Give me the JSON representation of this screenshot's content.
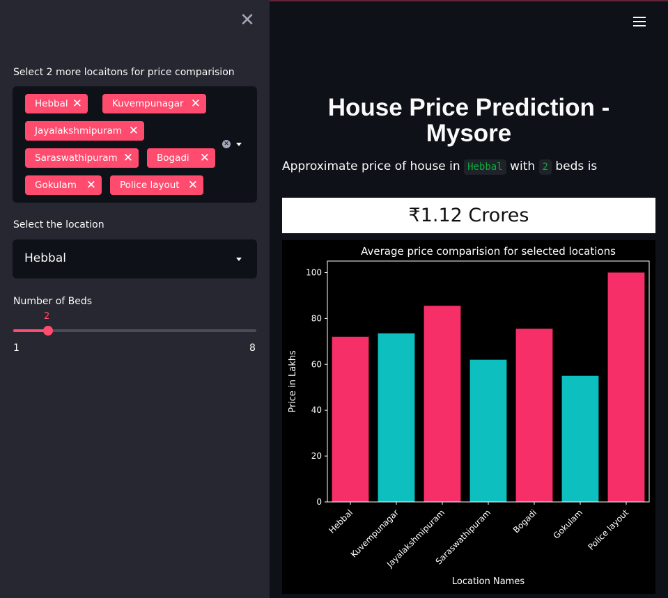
{
  "sidebar": {
    "close_icon": "close-icon",
    "multiselect_label": "Select 2 more locaitons for price comparision",
    "selected_locations": [
      "Hebbal",
      "Kuvempunagar",
      "Jayalakshmipuram",
      "Saraswathipuram",
      "Bogadi",
      "Gokulam",
      "Police layout"
    ],
    "location_label": "Select the location",
    "location_value": "Hebbal",
    "beds_label": "Number of Beds",
    "beds_value": "2",
    "beds_min": "1",
    "beds_max": "8"
  },
  "main": {
    "title": "House Price Prediction - Mysore",
    "approx_prefix": "Approximate price of house in",
    "approx_location": "Hebbal",
    "approx_mid": "with",
    "approx_beds": "2",
    "approx_suffix": "beds is",
    "price": "₹1.12 Crores"
  },
  "colors": {
    "accent": "#ff4b6e",
    "pink_bar": "#f72f68",
    "teal_bar": "#0dbfbf",
    "sidebar_bg": "#262730",
    "main_bg": "#0e1117"
  },
  "chart_data": {
    "type": "bar",
    "title": "Average price comparision for selected locations",
    "xlabel": "Location Names",
    "ylabel": "Price in Lakhs",
    "categories": [
      "Hebbal",
      "Kuvempunagar",
      "Jayalakshmipuram",
      "Saraswathipuram",
      "Bogadi",
      "Gokulam",
      "Police layout"
    ],
    "values": [
      72,
      73.5,
      85.5,
      62,
      75.5,
      55,
      100
    ],
    "bar_colors": [
      "#f72f68",
      "#0dbfbf",
      "#f72f68",
      "#0dbfbf",
      "#f72f68",
      "#0dbfbf",
      "#f72f68"
    ],
    "ylim": [
      0,
      105
    ],
    "yticks": [
      0,
      20,
      40,
      60,
      80,
      100
    ],
    "grid": false
  }
}
